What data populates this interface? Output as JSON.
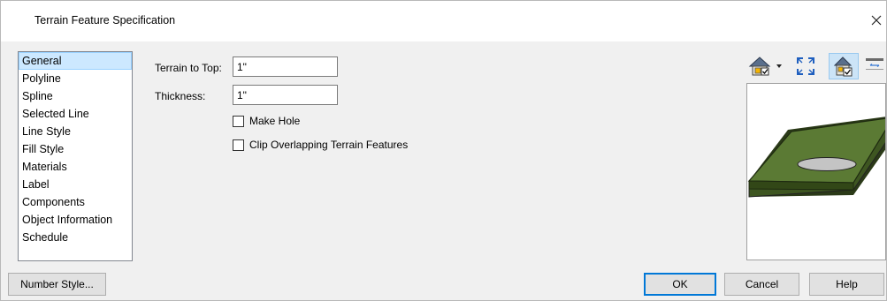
{
  "dialog": {
    "title": "Terrain Feature Specification"
  },
  "categories": [
    {
      "label": "General",
      "selected": true
    },
    {
      "label": "Polyline",
      "selected": false
    },
    {
      "label": "Spline",
      "selected": false
    },
    {
      "label": "Selected Line",
      "selected": false
    },
    {
      "label": "Line Style",
      "selected": false
    },
    {
      "label": "Fill Style",
      "selected": false
    },
    {
      "label": "Materials",
      "selected": false
    },
    {
      "label": "Label",
      "selected": false
    },
    {
      "label": "Components",
      "selected": false
    },
    {
      "label": "Object Information",
      "selected": false
    },
    {
      "label": "Schedule",
      "selected": false
    }
  ],
  "general": {
    "terrain_to_top": {
      "label": "Terrain to Top:",
      "value": "1\""
    },
    "thickness": {
      "label": "Thickness:",
      "value": "1\""
    },
    "make_hole": {
      "label": "Make Hole",
      "checked": false
    },
    "clip_overlapping": {
      "label": "Clip Overlapping Terrain Features",
      "checked": false
    }
  },
  "preview_toolbar": {
    "buttons": [
      {
        "icon": "camera-view-icon",
        "has_dropdown": true
      },
      {
        "icon": "fill-window-icon"
      },
      {
        "icon": "show-selected-icon",
        "pressed": true
      },
      {
        "icon": "preview-toggle-icon"
      }
    ]
  },
  "preview": {
    "colors": {
      "slab_top": "#5b7a34",
      "slab_edge": "#3e5621",
      "hole": "#c4c4c4"
    }
  },
  "buttons": {
    "number_style": "Number Style...",
    "ok": "OK",
    "cancel": "Cancel",
    "help": "Help"
  }
}
